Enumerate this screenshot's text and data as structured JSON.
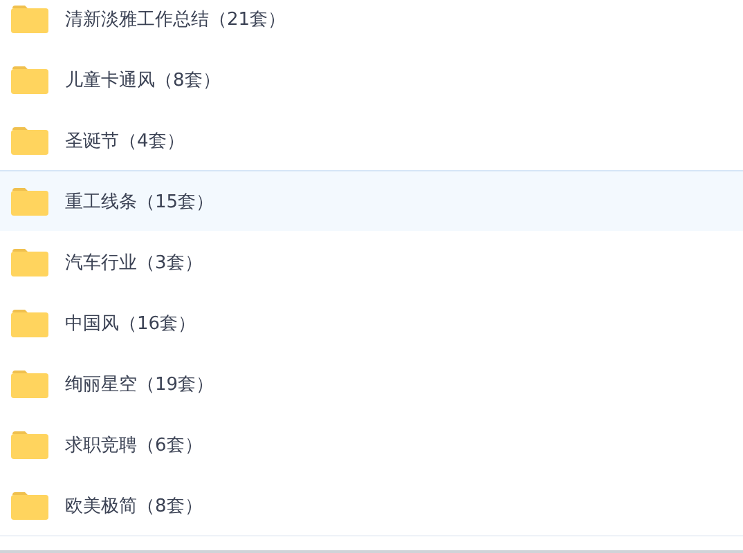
{
  "folders": [
    {
      "name": "清新淡雅工作总结（21套）",
      "selected": false
    },
    {
      "name": "儿童卡通风（8套）",
      "selected": false
    },
    {
      "name": "圣诞节（4套）",
      "selected": false
    },
    {
      "name": "重工线条（15套）",
      "selected": true
    },
    {
      "name": "汽车行业（3套）",
      "selected": false
    },
    {
      "name": "中国风（16套）",
      "selected": false
    },
    {
      "name": "绚丽星空（19套）",
      "selected": false
    },
    {
      "name": "求职竞聘（6套）",
      "selected": false
    },
    {
      "name": "欧美极简（8套）",
      "selected": false
    }
  ]
}
